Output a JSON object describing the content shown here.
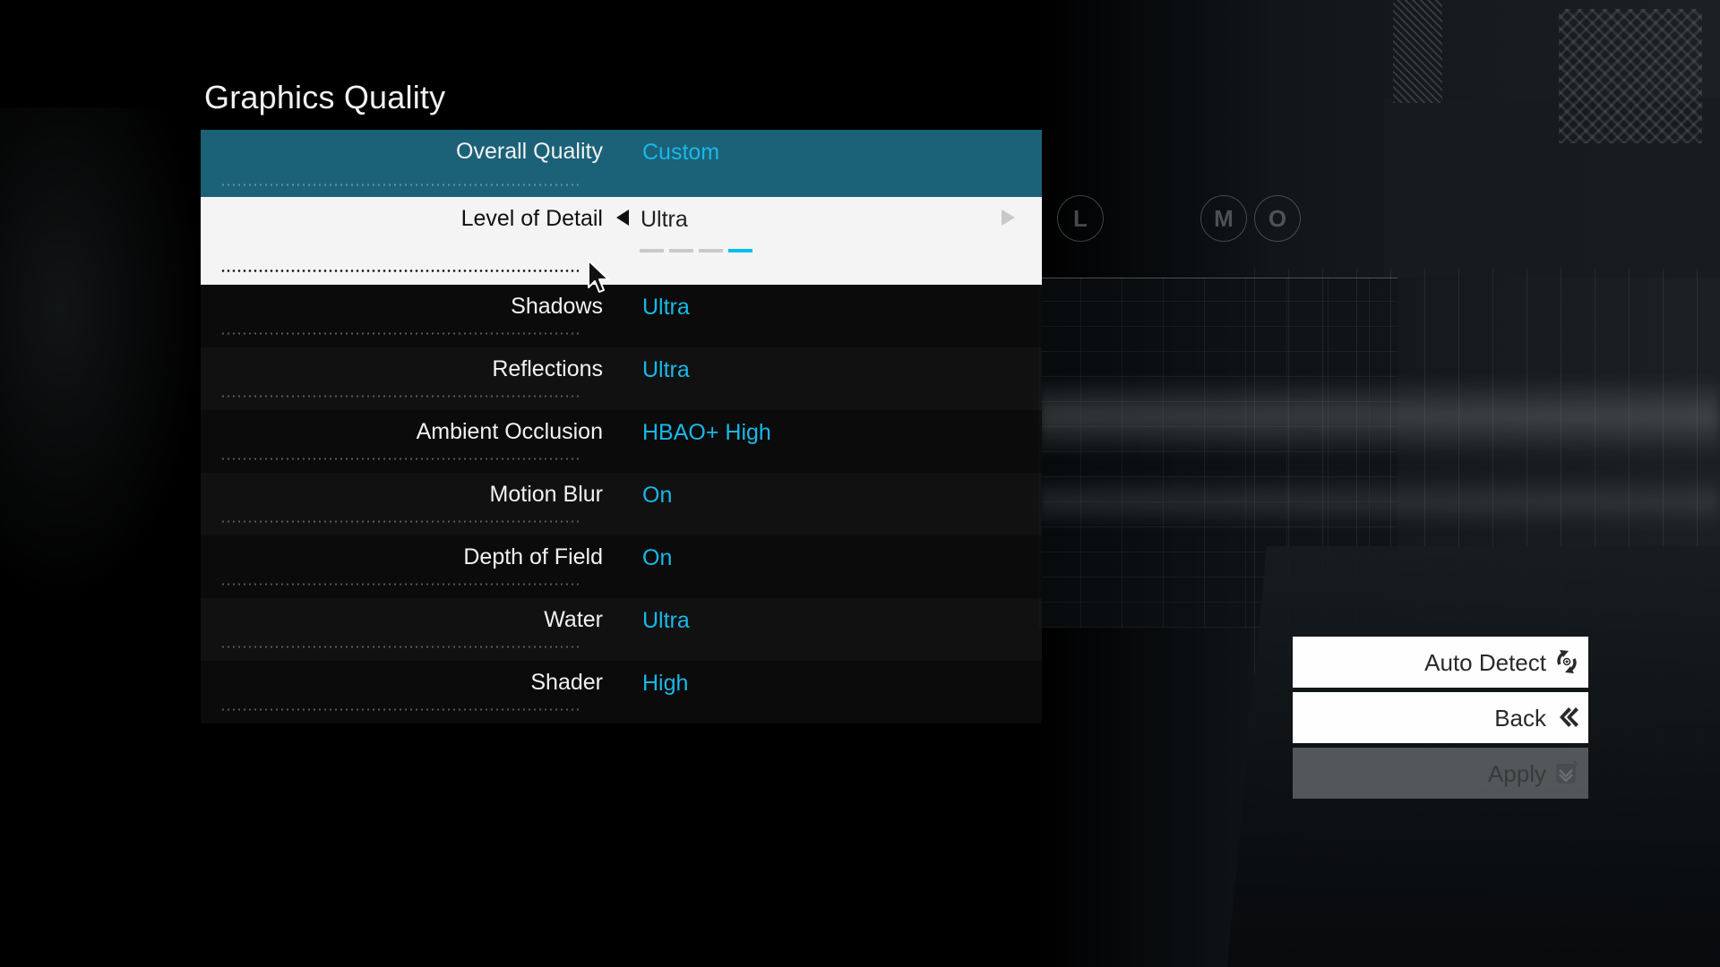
{
  "page": {
    "title": "Graphics Quality"
  },
  "colors": {
    "accent": "#19b8e8",
    "highlight_row": "#1b6278",
    "selected_row": "#f4f4f4"
  },
  "settings": [
    {
      "label": "Overall Quality",
      "value": "Custom",
      "state": "highlighted"
    },
    {
      "label": "Level of Detail",
      "value": "Ultra",
      "state": "selected",
      "level_index": 4,
      "level_count": 4
    },
    {
      "label": "Shadows",
      "value": "Ultra"
    },
    {
      "label": "Reflections",
      "value": "Ultra"
    },
    {
      "label": "Ambient Occlusion",
      "value": "HBAO+ High"
    },
    {
      "label": "Motion Blur",
      "value": "On"
    },
    {
      "label": "Depth of Field",
      "value": "On"
    },
    {
      "label": "Water",
      "value": "Ultra"
    },
    {
      "label": "Shader",
      "value": "High"
    }
  ],
  "actions": {
    "auto_detect": {
      "label": "Auto Detect",
      "icon": "auto-detect-icon"
    },
    "back": {
      "label": "Back",
      "icon": "double-chevron-left-icon"
    },
    "apply": {
      "label": "Apply",
      "icon": "checkbox-icon",
      "enabled": false
    }
  },
  "background_signs": [
    "L",
    "M",
    "O"
  ]
}
